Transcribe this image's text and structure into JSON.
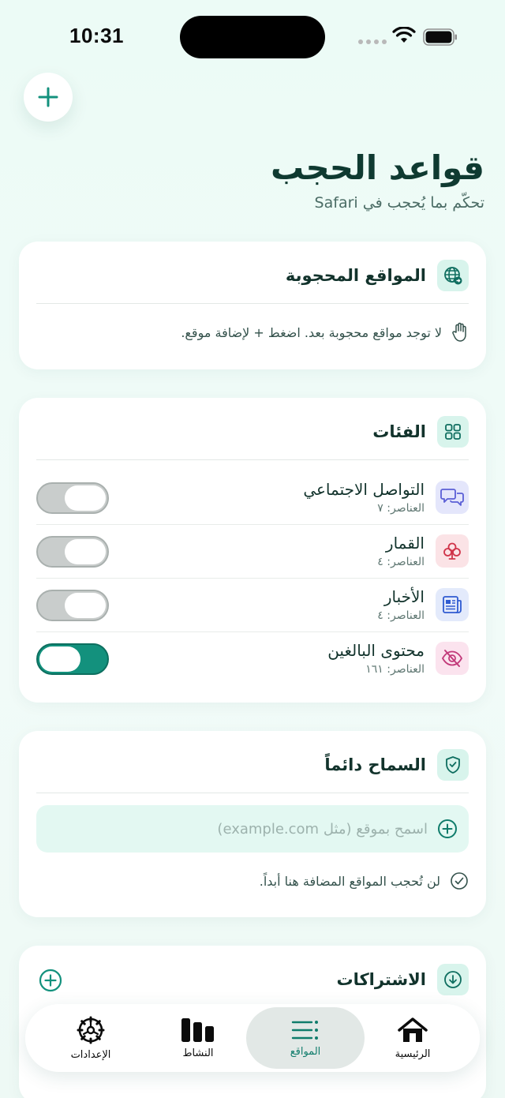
{
  "status": {
    "time": "10:31"
  },
  "header": {
    "title": "قواعد الحجب",
    "subtitle": "تحكّم بما يُحجب في Safari"
  },
  "blocked_sites": {
    "title": "المواقع المحجوبة",
    "empty_message": "لا توجد مواقع محجوبة بعد. اضغط + لإضافة موقع."
  },
  "categories": {
    "title": "الفئات",
    "items": [
      {
        "name": "التواصل الاجتماعي",
        "count": "العناصر: ٧",
        "enabled": false,
        "color": "#5b5fd6"
      },
      {
        "name": "القمار",
        "count": "العناصر: ٤",
        "enabled": false,
        "color": "#d0344a"
      },
      {
        "name": "الأخبار",
        "count": "العناصر: ٤",
        "enabled": false,
        "color": "#2f5bd1"
      },
      {
        "name": "محتوى البالغين",
        "count": "العناصر: ١٦١",
        "enabled": true,
        "color": "#c23a7a"
      }
    ]
  },
  "allow_always": {
    "title": "السماح دائماً",
    "input_placeholder": "اسمح بموقع (مثل example.com)",
    "note": "لن تُحجب المواقع المضافة هنا أبداً."
  },
  "subscriptions": {
    "title": "الاشتراكات"
  },
  "tabs": [
    {
      "label": "الرئيسية",
      "icon": "house-icon"
    },
    {
      "label": "المواقع",
      "icon": "list-icon",
      "active": true
    },
    {
      "label": "النشاط",
      "icon": "bar-chart-icon"
    },
    {
      "label": "الإعدادات",
      "icon": "gear-icon"
    }
  ],
  "colors": {
    "accent": "#13917d",
    "accent_dark": "#0f7c6b",
    "background": "#ecfbf6"
  }
}
